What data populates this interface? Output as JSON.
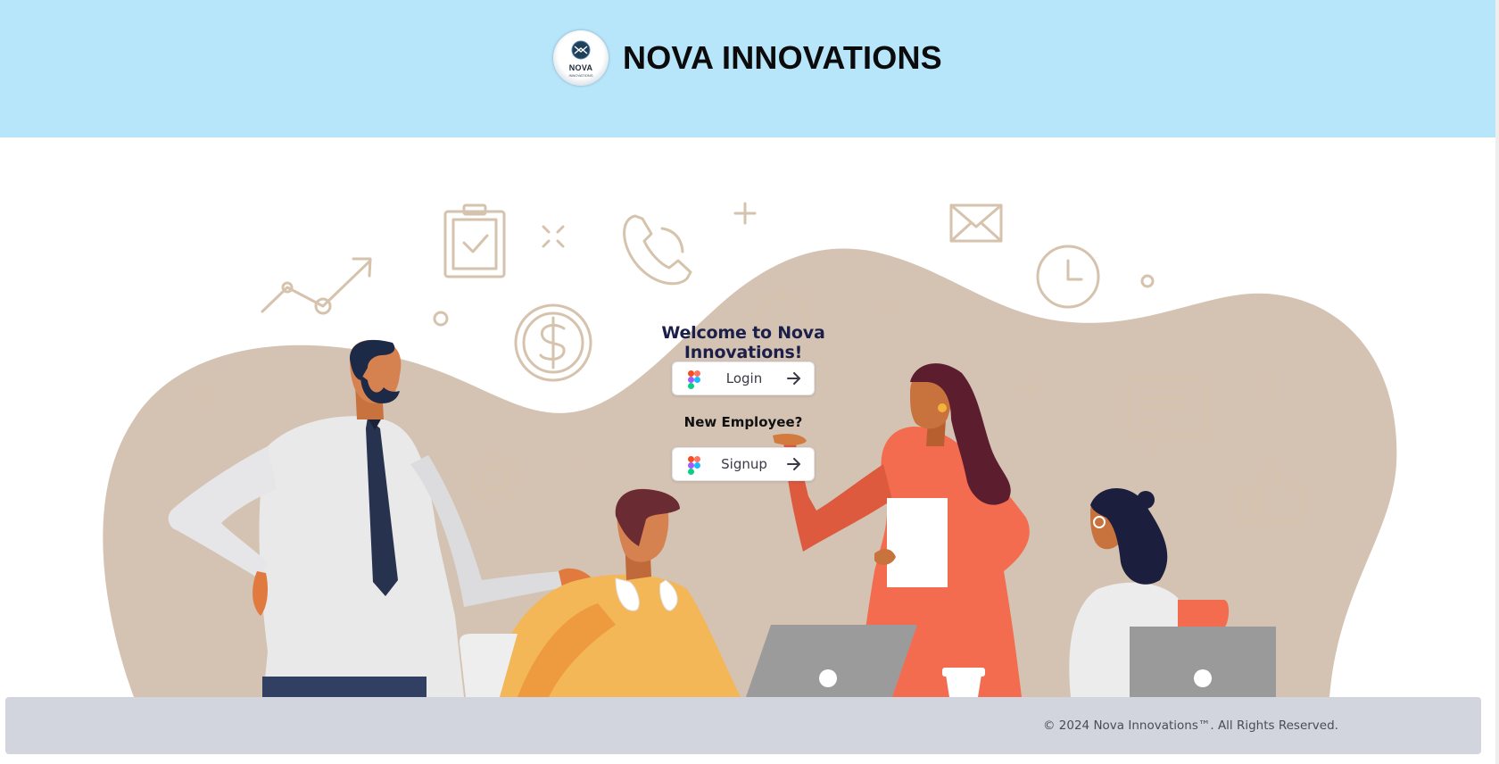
{
  "header": {
    "brand_name": "NOVA INNOVATIONS",
    "logo_text": "NOVA",
    "logo_subtext": "INNOVATIONS"
  },
  "main": {
    "welcome_text": "Welcome to Nova Innovations!",
    "login": {
      "label": "Login",
      "icon": "figma-icon"
    },
    "new_employee_text": "New Employee?",
    "signup": {
      "label": "Signup",
      "icon": "figma-icon"
    }
  },
  "footer": {
    "copyright": "© 2024 Nova Innovations™. All Rights Reserved."
  },
  "colors": {
    "header_bg": "#b7e5fa",
    "footer_bg": "#d2d5dd",
    "welcome_text": "#1b1f4a",
    "blob": "#d4c3b2"
  }
}
